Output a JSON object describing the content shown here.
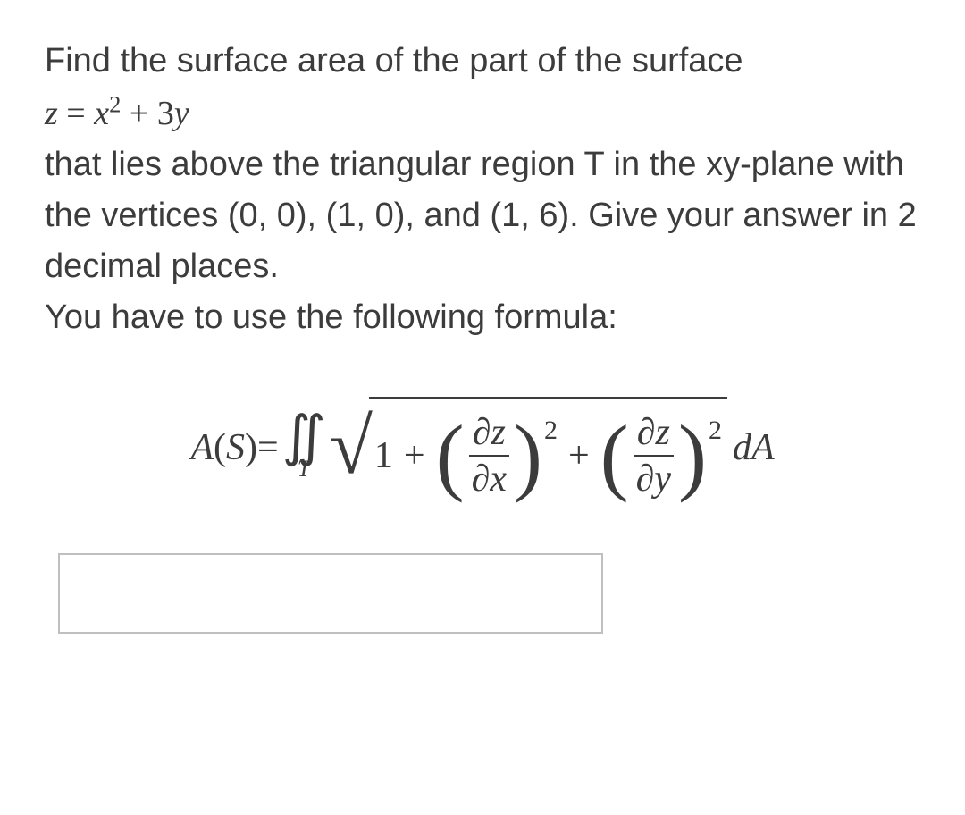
{
  "problem": {
    "line1": "Find the surface area of the part of the surface",
    "equation_z": "z",
    "equation_eq": " = ",
    "equation_x": "x",
    "equation_exp": "2",
    "equation_plus": " + 3",
    "equation_y": "y",
    "line3": "that lies above the triangular region T in the xy-plane with the vertices (0, 0), (1, 0), and (1, 6). Give your answer in 2 decimal places.",
    "line4": "You have to use the following formula:"
  },
  "formula": {
    "lhs_A": "A",
    "lhs_paren_open": "(",
    "lhs_S": "S",
    "lhs_paren_close": ")",
    "equals": " = ",
    "integral_region": "T",
    "one": "1",
    "plus": "+",
    "dz": "∂z",
    "dx": "∂x",
    "dy": "∂y",
    "exp2": "2",
    "dA_d": "d",
    "dA_A": "A"
  },
  "answer": {
    "value": ""
  }
}
